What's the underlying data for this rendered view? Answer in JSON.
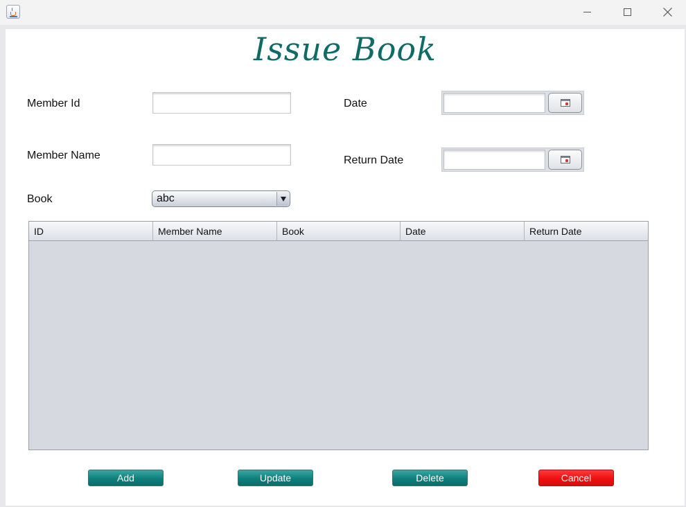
{
  "window": {
    "minimize_icon": "minimize-icon",
    "maximize_icon": "maximize-icon",
    "close_icon": "close-icon"
  },
  "page": {
    "title": "Issue Book"
  },
  "form": {
    "member_id_label": "Member Id",
    "member_id_value": "",
    "member_name_label": "Member Name",
    "member_name_value": "",
    "book_label": "Book",
    "book_selected": "abc",
    "date_label": "Date",
    "date_value": "",
    "return_date_label": "Return Date",
    "return_date_value": ""
  },
  "table": {
    "columns": [
      "ID",
      "Member Name",
      "Book",
      "Date",
      "Return Date"
    ],
    "rows": []
  },
  "buttons": {
    "add": "Add",
    "update": "Update",
    "delete": "Delete",
    "cancel": "Cancel"
  },
  "colors": {
    "title": "#0f6b66",
    "action_button": "#0e7f7b",
    "cancel_button": "#ee1010",
    "table_body": "#d6d9e0"
  }
}
